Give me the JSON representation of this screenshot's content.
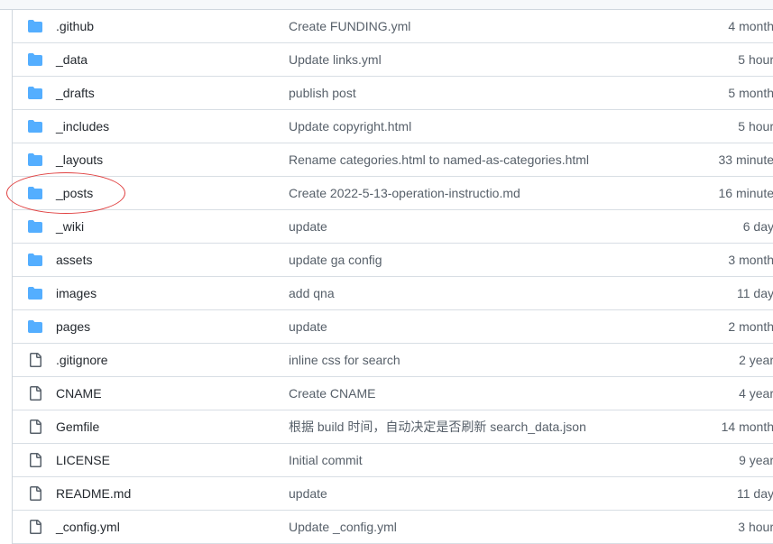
{
  "colors": {
    "folder_icon": "#54aeff",
    "file_icon": "#57606a",
    "annotation": "#e04040"
  },
  "files": [
    {
      "type": "folder",
      "name": ".github",
      "message": "Create FUNDING.yml",
      "age": "4 month"
    },
    {
      "type": "folder",
      "name": "_data",
      "message": "Update links.yml",
      "age": "5 hour"
    },
    {
      "type": "folder",
      "name": "_drafts",
      "message": "publish post",
      "age": "5 month"
    },
    {
      "type": "folder",
      "name": "_includes",
      "message": "Update copyright.html",
      "age": "5 hour"
    },
    {
      "type": "folder",
      "name": "_layouts",
      "message": "Rename categories.html to named-as-categories.html",
      "age": "33 minute"
    },
    {
      "type": "folder",
      "name": "_posts",
      "message": "Create 2022-5-13-operation-instructio.md",
      "age": "16 minute"
    },
    {
      "type": "folder",
      "name": "_wiki",
      "message": "update",
      "age": "6 day"
    },
    {
      "type": "folder",
      "name": "assets",
      "message": "update ga config",
      "age": "3 month"
    },
    {
      "type": "folder",
      "name": "images",
      "message": "add qna",
      "age": "11 day"
    },
    {
      "type": "folder",
      "name": "pages",
      "message": "update",
      "age": "2 month"
    },
    {
      "type": "file",
      "name": ".gitignore",
      "message": "inline css for search",
      "age": "2 year"
    },
    {
      "type": "file",
      "name": "CNAME",
      "message": "Create CNAME",
      "age": "4 year"
    },
    {
      "type": "file",
      "name": "Gemfile",
      "message": "根据 build 时间，自动决定是否刷新 search_data.json",
      "age": "14 month"
    },
    {
      "type": "file",
      "name": "LICENSE",
      "message": "Initial commit",
      "age": "9 year"
    },
    {
      "type": "file",
      "name": "README.md",
      "message": "update",
      "age": "11 day"
    },
    {
      "type": "file",
      "name": "_config.yml",
      "message": "Update _config.yml",
      "age": "3 hour"
    }
  ]
}
